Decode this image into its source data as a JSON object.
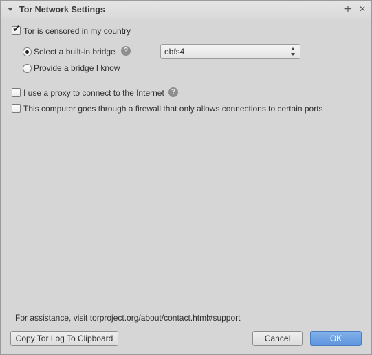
{
  "window": {
    "title": "Tor Network Settings",
    "add_glyph": "+",
    "close_glyph": "✕"
  },
  "options": {
    "censored_label": "Tor is censored in my country",
    "censored_checked": true,
    "builtin_bridge_label": "Select a built-in bridge",
    "builtin_bridge_selected": true,
    "bridge_type_value": "obfs4",
    "provide_bridge_label": "Provide a bridge I know",
    "proxy_label": "I use a proxy to connect to the Internet",
    "proxy_checked": false,
    "firewall_label": "This computer goes through a firewall that only allows connections to certain ports",
    "firewall_checked": false,
    "help_glyph": "?"
  },
  "footer": {
    "assistance_text": "For assistance, visit torproject.org/about/contact.html#support",
    "copy_log_label": "Copy Tor Log To Clipboard",
    "cancel_label": "Cancel",
    "ok_label": "OK"
  },
  "icons": {
    "collapse": "triangle-down-icon",
    "add": "plus-icon",
    "close": "close-icon",
    "help": "question-mark-icon"
  }
}
